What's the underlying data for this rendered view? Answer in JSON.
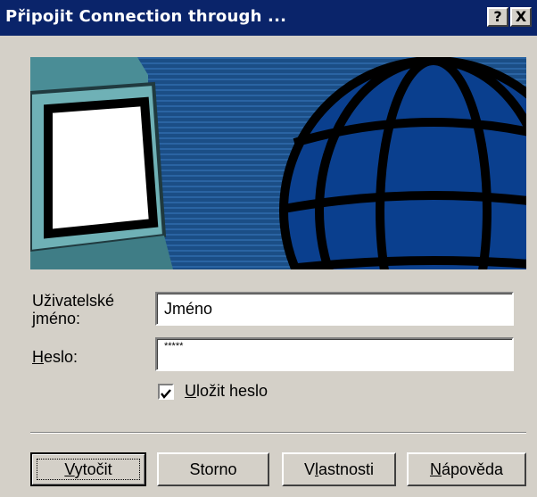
{
  "window": {
    "title": "Připojit Connection through ...",
    "help_button": "?",
    "close_button": "X"
  },
  "form": {
    "username_label_line1": "Uživatelské",
    "username_label_line2_mn": "j",
    "username_label_line2_pre": "",
    "username_label_line2_post": "méno:",
    "username_value": "Jméno",
    "password_label_mn": "H",
    "password_label_rest": "eslo:",
    "password_value": "*****",
    "save_password_mn": "U",
    "save_password_rest": "ložit heslo",
    "save_password_checked": true
  },
  "buttons": {
    "dial_mn": "V",
    "dial_rest": "ytočit",
    "cancel": "Storno",
    "properties_pre": "V",
    "properties_mn": "l",
    "properties_post": "astnosti",
    "help_mn": "N",
    "help_rest": "ápověda"
  },
  "colors": {
    "titlebar": "#0a246a",
    "face": "#d4d0c8",
    "illustration_bg": "#1a4f8a",
    "globe": "#0b3f8f",
    "monitor": "#5b9ea6"
  }
}
